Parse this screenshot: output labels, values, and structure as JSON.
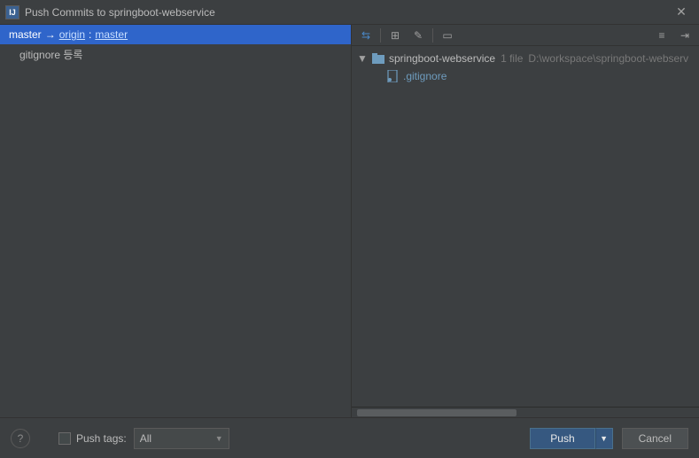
{
  "window": {
    "title": "Push Commits to springboot-webservice"
  },
  "branch": {
    "local": "master",
    "arrow": "→",
    "remote_repo": "origin",
    "colon": ":",
    "remote_branch": "master"
  },
  "commits": [
    {
      "message": "gitignore 등록"
    }
  ],
  "toolbar": {
    "icon_diff": "⇆",
    "icon_group": "⊞",
    "icon_edit": "✎",
    "icon_preview": "▭",
    "icon_expand": "≡",
    "icon_collapse": "⇥"
  },
  "tree": {
    "root": {
      "expand": "▼",
      "name": "springboot-webservice",
      "meta_count": "1 file",
      "meta_path": "D:\\workspace\\springboot-webserv"
    },
    "file": {
      "name": ".gitignore"
    }
  },
  "footer": {
    "help": "?",
    "push_tags_label": "Push tags:",
    "dropdown_value": "All",
    "dropdown_arrow": "▼",
    "push_label": "Push",
    "push_dd": "▼",
    "cancel_label": "Cancel"
  }
}
